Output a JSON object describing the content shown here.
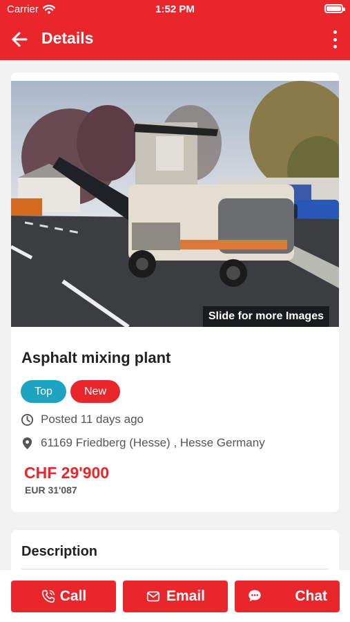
{
  "status_bar": {
    "carrier": "Carrier",
    "time": "1:52 PM"
  },
  "header": {
    "title": "Details"
  },
  "listing": {
    "image_caption": "Slide for more Images",
    "title": "Asphalt mixing plant",
    "badges": {
      "top": "Top",
      "new": "New"
    },
    "posted": "Posted 11 days ago",
    "location": "61169 Friedberg (Hesse) , Hesse Germany",
    "price_primary": "CHF 29'900",
    "price_secondary": "EUR 31'087"
  },
  "description": {
    "heading": "Description"
  },
  "actions": {
    "call": "Call",
    "email": "Email",
    "chat": "Chat"
  },
  "colors": {
    "brand_red": "#e8262b",
    "top_badge": "#1ea4c1"
  },
  "icons": [
    "wifi-icon",
    "battery-icon",
    "back-arrow-icon",
    "more-vertical-icon",
    "clock-icon",
    "location-pin-icon",
    "phone-icon",
    "mail-icon",
    "chat-bubble-icon"
  ]
}
